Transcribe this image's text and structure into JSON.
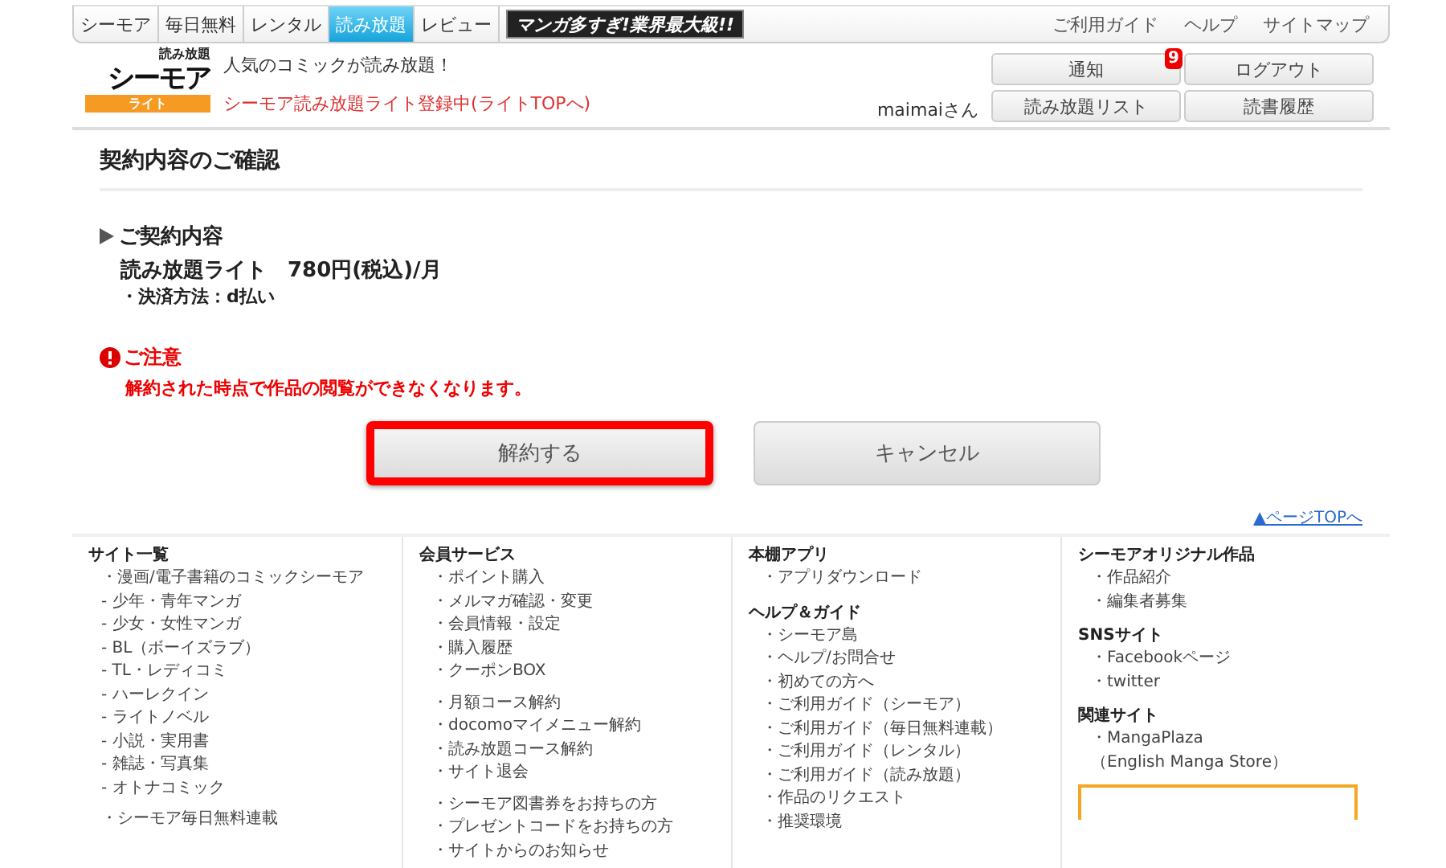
{
  "nav": {
    "tabs": [
      {
        "label": "シーモア",
        "selected": false
      },
      {
        "label": "毎日無料",
        "selected": false
      },
      {
        "label": "レンタル",
        "selected": false
      },
      {
        "label": "読み放題",
        "selected": true
      },
      {
        "label": "レビュー",
        "selected": false
      }
    ],
    "banner": "マンガ多すぎ!業界最大級!!",
    "links": [
      "ご利用ガイド",
      "ヘルプ",
      "サイトマップ"
    ]
  },
  "header": {
    "logo": {
      "top": "読み放題",
      "main": "シーモア",
      "sub": "ライト"
    },
    "tagline": "人気のコミックが読み放題！",
    "status_link": "シーモア読み放題ライト登録中(ライトTOPへ)",
    "user": "maimaiさん",
    "buttons": [
      {
        "label": "通知",
        "badge": "9"
      },
      {
        "label": "ログアウト"
      },
      {
        "label": "読み放題リスト"
      },
      {
        "label": "読書履歴"
      }
    ]
  },
  "main": {
    "title": "契約内容のご確認",
    "section_heading": "ご契約内容",
    "plan": "読み放題ライト　780円(税込)/月",
    "payment": "・決済方法：d払い",
    "notice_heading": "ご注意",
    "notice": "解約された時点で作品の閲覧ができなくなります。",
    "buttons": [
      {
        "label": "解約する",
        "highlighted": true
      },
      {
        "label": "キャンセル",
        "highlighted": false
      }
    ],
    "page_top": "▲ページTOPへ"
  },
  "footer": {
    "columns": [
      {
        "sections": [
          {
            "heading": "サイト一覧",
            "groups": [
              [
                "・漫画/電子書籍のコミックシーモア",
                "- 少年・青年マンガ",
                "- 少女・女性マンガ",
                "- BL（ボーイズラブ）",
                "- TL・レディコミ",
                "- ハーレクイン",
                "- ライトノベル",
                "- 小説・実用書",
                "- 雑誌・写真集",
                "- オトナコミック"
              ],
              [
                "・シーモア毎日無料連載"
              ]
            ]
          }
        ]
      },
      {
        "sections": [
          {
            "heading": "会員サービス",
            "groups": [
              [
                "・ポイント購入",
                "・メルマガ確認・変更",
                "・会員情報・設定",
                "・購入履歴",
                "・クーポンBOX"
              ],
              [
                "・月額コース解約",
                "・docomoマイメニュー解約",
                "・読み放題コース解約",
                "・サイト退会"
              ],
              [
                "・シーモア図書券をお持ちの方",
                "・プレゼントコードをお持ちの方",
                "・サイトからのお知らせ"
              ]
            ]
          }
        ]
      },
      {
        "sections": [
          {
            "heading": "本棚アプリ",
            "groups": [
              [
                "・アプリダウンロード"
              ]
            ]
          },
          {
            "heading": "ヘルプ＆ガイド",
            "groups": [
              [
                "・シーモア島",
                "・ヘルプ/お問合せ",
                "・初めての方へ",
                "・ご利用ガイド（シーモア）",
                "・ご利用ガイド（毎日無料連載）",
                "・ご利用ガイド（レンタル）",
                "・ご利用ガイド（読み放題）",
                "・作品のリクエスト",
                "・推奨環境"
              ]
            ]
          }
        ]
      },
      {
        "sections": [
          {
            "heading": "シーモアオリジナル作品",
            "groups": [
              [
                "・作品紹介",
                "・編集者募集"
              ]
            ]
          },
          {
            "heading": "SNSサイト",
            "groups": [
              [
                "・Facebookページ",
                "・twitter"
              ]
            ]
          },
          {
            "heading": "関連サイト",
            "groups": [
              [
                "・MangaPlaza",
                "（English Manga Store）"
              ]
            ]
          }
        ]
      }
    ]
  }
}
